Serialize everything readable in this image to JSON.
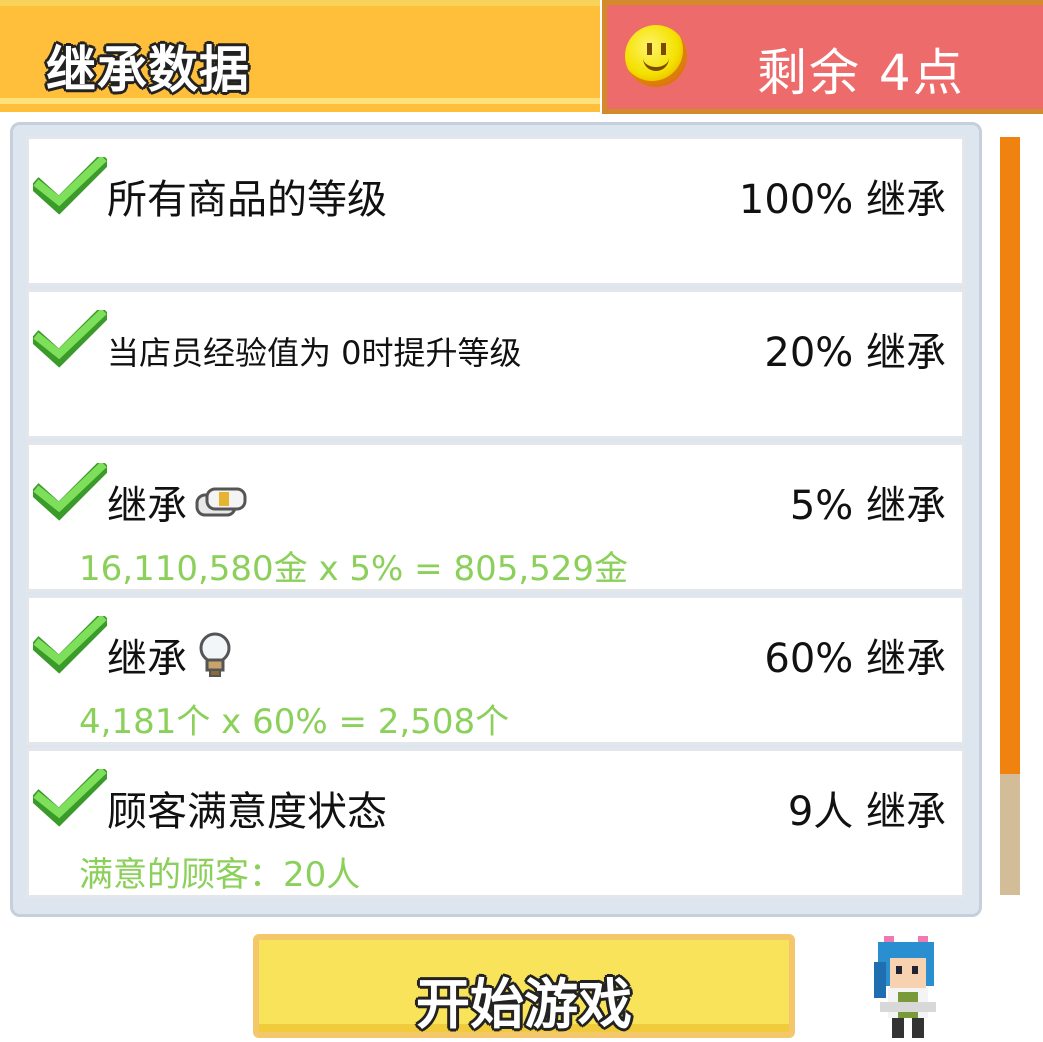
{
  "header": {
    "title": "继承数据",
    "points_label": "剩余 4点"
  },
  "rows": [
    {
      "label": "所有商品的等级",
      "value": "100% 继承",
      "detail": ""
    },
    {
      "label": "当店员经验值为 0时提升等级",
      "value": "20% 继承",
      "detail": ""
    },
    {
      "label": "继承",
      "icon": "money-icon",
      "value": "5% 继承",
      "detail": "16,110,580金 x 5% = 805,529金"
    },
    {
      "label": "继承",
      "icon": "lightbulb-icon",
      "value": "60% 继承",
      "detail": "4,181个 x 60% = 2,508个"
    },
    {
      "label": "顾客满意度状态",
      "value": "9人 继承",
      "detail": "满意的顾客：20人"
    }
  ],
  "start_button": {
    "label": "开始游戏"
  },
  "colors": {
    "title_bg": "#ffbf3a",
    "points_bg": "#ee6b6b",
    "check_green": "#6fd04a",
    "detail_green": "#8bd05a",
    "scroll_thumb": "#f0830f",
    "button_bg": "#f8e35a"
  },
  "scroll": {
    "thumb_fraction": 0.84
  }
}
